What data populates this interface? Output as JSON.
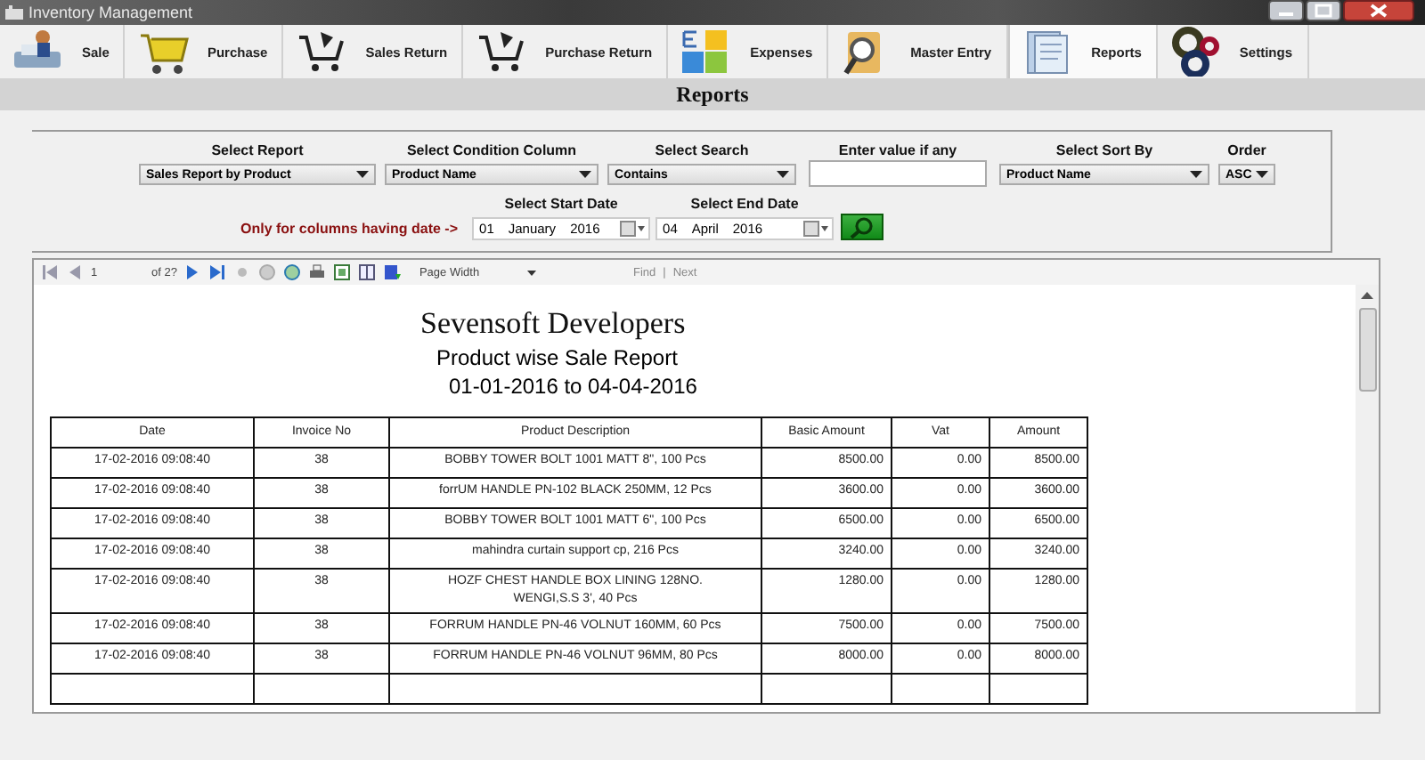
{
  "window": {
    "title": "Inventory Management"
  },
  "toolbar": [
    {
      "label": "Sale",
      "kind": "sale",
      "selected": false
    },
    {
      "label": "Purchase",
      "kind": "cart",
      "selected": false
    },
    {
      "label": "Sales Return",
      "kind": "return",
      "selected": false
    },
    {
      "label": "Purchase Return",
      "kind": "return",
      "selected": false
    },
    {
      "label": "Expenses",
      "kind": "expenses",
      "selected": false
    },
    {
      "label": "Master Entry",
      "kind": "master",
      "selected": false
    },
    {
      "label": "Reports",
      "kind": "reports",
      "selected": true
    },
    {
      "label": "Settings",
      "kind": "gears",
      "selected": false
    }
  ],
  "page_title": "Reports",
  "filters": {
    "report": {
      "label": "Select Report",
      "value": "Sales Report by Product"
    },
    "condition": {
      "label": "Select Condition Column",
      "value": "Product Name"
    },
    "search": {
      "label": "Select Search",
      "value": "Contains"
    },
    "value": {
      "label": "Enter value if any"
    },
    "sort": {
      "label": "Select Sort By",
      "value": "Product Name"
    },
    "order": {
      "label": "Order",
      "value": "ASC"
    },
    "date_note": "Only for columns having date ->",
    "start": {
      "label": "Select Start Date",
      "day": "01",
      "month": "January",
      "year": "2016"
    },
    "end": {
      "label": "Select End Date",
      "day": "04",
      "month": "April",
      "year": "2016"
    }
  },
  "viewer_toolbar": {
    "page": "1",
    "of": "of 2?",
    "zoom": "Page Width",
    "find": "Find",
    "separator": "|",
    "next": "Next"
  },
  "report": {
    "company": "Sevensoft Developers",
    "title": "Product wise Sale Report",
    "period": "01-01-2016 to 04-04-2016",
    "columns": [
      "Date",
      "Invoice No",
      "Product Description",
      "Basic Amount",
      "Vat",
      "Amount"
    ],
    "rows": [
      [
        "17-02-2016 09:08:40",
        "38",
        "BOBBY TOWER BOLT 1001 MATT 8\", 100 Pcs",
        "8500.00",
        "0.00",
        "8500.00"
      ],
      [
        "17-02-2016 09:08:40",
        "38",
        "forrUM HANDLE PN-102 BLACK 250MM, 12 Pcs",
        "3600.00",
        "0.00",
        "3600.00"
      ],
      [
        "17-02-2016 09:08:40",
        "38",
        "BOBBY TOWER BOLT 1001 MATT 6\", 100 Pcs",
        "6500.00",
        "0.00",
        "6500.00"
      ],
      [
        "17-02-2016 09:08:40",
        "38",
        "mahindra curtain support cp, 216 Pcs",
        "3240.00",
        "0.00",
        "3240.00"
      ],
      [
        "17-02-2016 09:08:40",
        "38",
        "HOZF CHEST HANDLE BOX LINING 128NO. WENGI,S.S 3', 40 Pcs",
        "1280.00",
        "0.00",
        "1280.00"
      ],
      [
        "17-02-2016 09:08:40",
        "38",
        "FORRUM HANDLE PN-46 VOLNUT 160MM, 60 Pcs",
        "7500.00",
        "0.00",
        "7500.00"
      ],
      [
        "17-02-2016 09:08:40",
        "38",
        "FORRUM HANDLE PN-46 VOLNUT 96MM, 80 Pcs",
        "8000.00",
        "0.00",
        "8000.00"
      ]
    ]
  }
}
